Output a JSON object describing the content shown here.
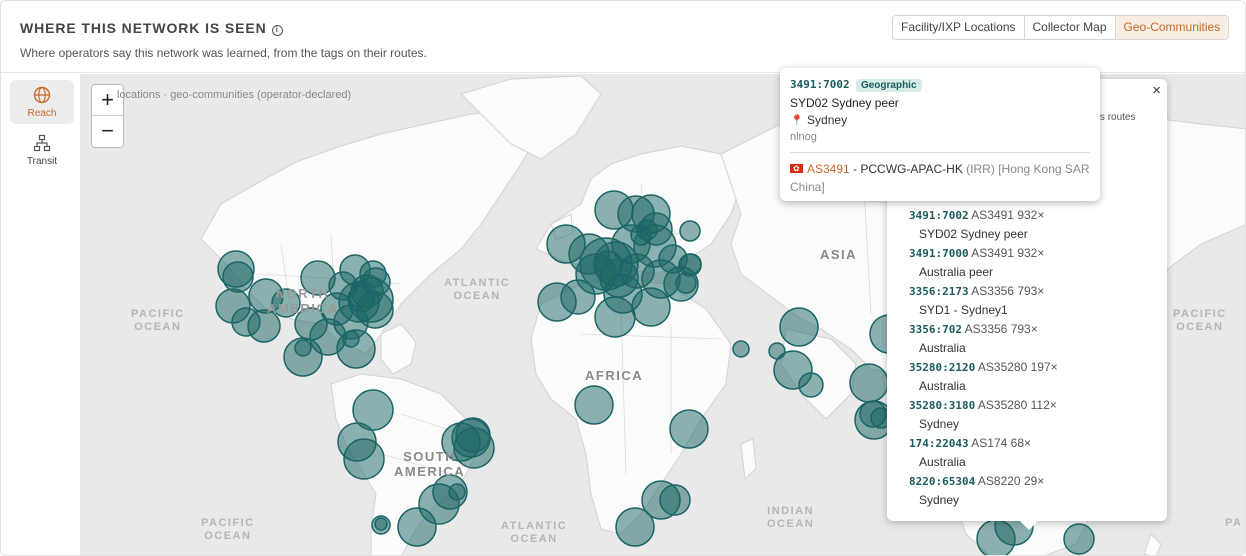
{
  "header": {
    "title": "WHERE THIS NETWORK IS SEEN",
    "info_icon": "i",
    "subtitle": "Where operators say this network was learned, from the tags on their routes."
  },
  "view_tabs": [
    {
      "label": "Facility/IXP Locations",
      "active": false
    },
    {
      "label": "Collector Map",
      "active": false
    },
    {
      "label": "Geo-Communities",
      "active": true
    }
  ],
  "rail": {
    "reach_label": "Reach",
    "transit_label": "Transit"
  },
  "map": {
    "zoom_in": "+",
    "zoom_out": "−",
    "attribution": "locations · geo-communities (operator-declared)",
    "labels": {
      "pacific_left": "PACIFIC\nOCEAN",
      "atlantic_north": "ATLANTIC\nOCEAN",
      "north_america": "NORTH\nAMERICA",
      "south_america": "SOUTH\nAMERICA",
      "africa": "AFRICA",
      "asia": "ASIA",
      "indian_ocean": "INDIAN\nOCEAN",
      "atlantic_south": "ATLANTIC\nOCEAN",
      "pacific_south": "PACIFIC\nOCEAN",
      "pacific_right": "PACIFIC\nOCEAN",
      "pa_edge": "PA"
    },
    "marker_color": "#1b6566"
  },
  "tooltip": {
    "code": "3491:7002",
    "badge": "Geographic",
    "name": "SYD02 Sydney peer",
    "location_icon": "📍",
    "location": "Sydney",
    "source": "nlnog",
    "asn": "AS3491",
    "asn_sep": " - ",
    "asn_name": "PCCWG-APAC-HK",
    "asn_registry": "(IRR)",
    "asn_country": "[Hong Kong SAR China]"
  },
  "panel": {
    "close": "×",
    "hint": "k's routes",
    "entries": [
      {
        "code": "3491:7002",
        "asn": "AS3491 932×",
        "desc": "SYD02 Sydney peer"
      },
      {
        "code": "3491:7000",
        "asn": "AS3491 932×",
        "desc": "Australia peer"
      },
      {
        "code": "3356:2173",
        "asn": "AS3356 793×",
        "desc": "SYD1 - Sydney1"
      },
      {
        "code": "3356:702",
        "asn": "AS3356 793×",
        "desc": "Australia"
      },
      {
        "code": "35280:2120",
        "asn": "AS35280 197×",
        "desc": "Australia"
      },
      {
        "code": "35280:3180",
        "asn": "AS35280 112×",
        "desc": "Sydney"
      },
      {
        "code": "174:22043",
        "asn": "AS174 68×",
        "desc": "Australia"
      },
      {
        "code": "8220:65304",
        "asn": "AS8220 29×",
        "desc": "Sydney"
      }
    ]
  }
}
